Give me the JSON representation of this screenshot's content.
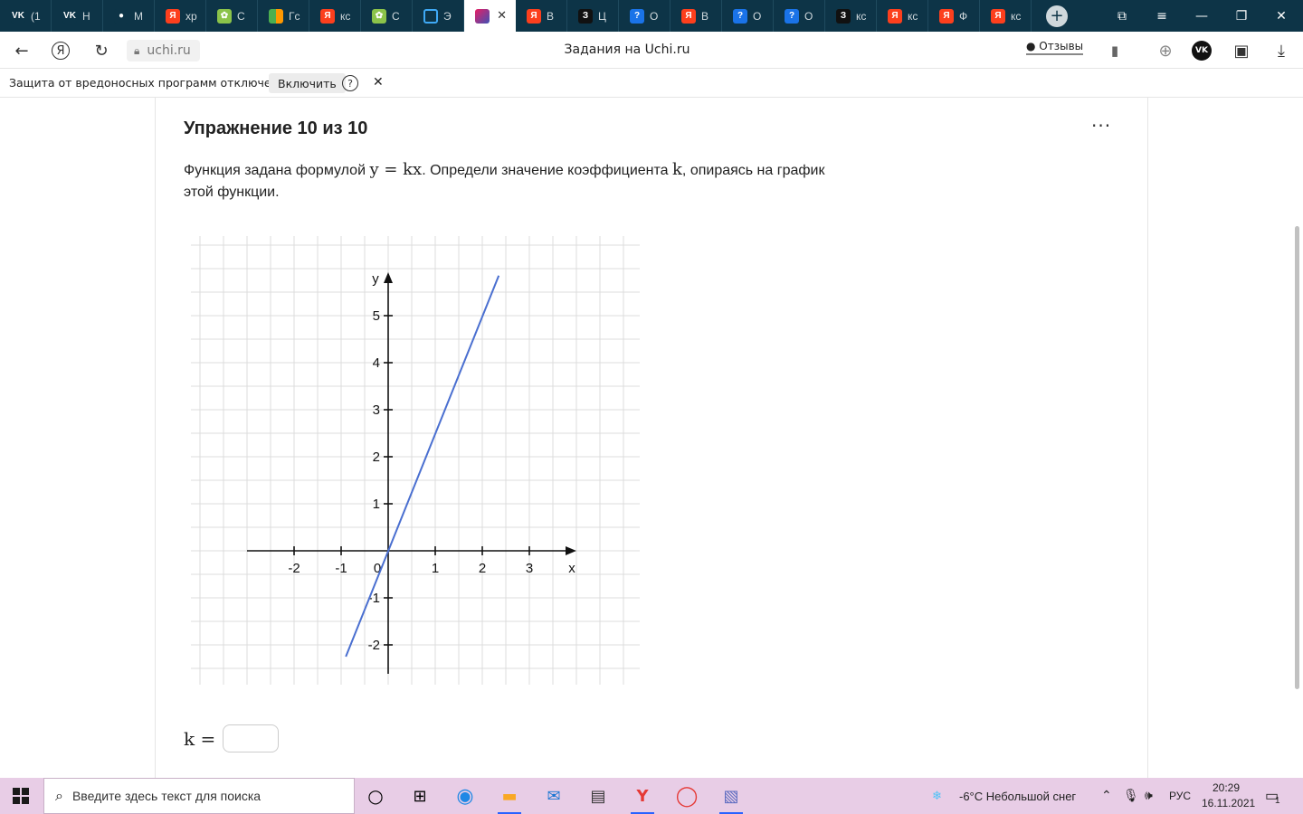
{
  "tabs": [
    {
      "label": "(1",
      "icon": "vk-icon",
      "fav": "VK",
      "cls": "fav-vk"
    },
    {
      "label": "Н",
      "icon": "vk-icon",
      "fav": "VK",
      "cls": "fav-vk"
    },
    {
      "label": "М",
      "icon": "chat-icon",
      "fav": "●",
      "cls": "fav-chat"
    },
    {
      "label": "хр",
      "icon": "yandex-icon",
      "fav": "Я",
      "cls": "fav-ya"
    },
    {
      "label": "С",
      "icon": "flower-icon",
      "fav": "✿",
      "cls": "fav-green"
    },
    {
      "label": "Гс",
      "icon": "book-icon",
      "fav": "",
      "cls": "fav-book"
    },
    {
      "label": "кс",
      "icon": "yandex-icon",
      "fav": "Я",
      "cls": "fav-ya"
    },
    {
      "label": "С",
      "icon": "flower-icon",
      "fav": "✿",
      "cls": "fav-green"
    },
    {
      "label": "Э",
      "icon": "edge-icon",
      "fav": "",
      "cls": "fav-edge"
    },
    {
      "label": "",
      "icon": "uchi-icon",
      "fav": "",
      "cls": "fav-uchi",
      "active": true
    },
    {
      "label": "В",
      "icon": "yandex-icon",
      "fav": "Я",
      "cls": "fav-ya"
    },
    {
      "label": "Ц",
      "icon": "z-icon",
      "fav": "З",
      "cls": "fav-z"
    },
    {
      "label": "О",
      "icon": "question-icon",
      "fav": "?",
      "cls": "fav-q"
    },
    {
      "label": "В",
      "icon": "yandex-icon",
      "fav": "Я",
      "cls": "fav-ya"
    },
    {
      "label": "О",
      "icon": "question-icon",
      "fav": "?",
      "cls": "fav-q"
    },
    {
      "label": "О",
      "icon": "question-icon",
      "fav": "?",
      "cls": "fav-q"
    },
    {
      "label": "кс",
      "icon": "z-icon",
      "fav": "З",
      "cls": "fav-z"
    },
    {
      "label": "кс",
      "icon": "yandex-icon",
      "fav": "Я",
      "cls": "fav-ya"
    },
    {
      "label": "Ф",
      "icon": "yandex-icon",
      "fav": "Я",
      "cls": "fav-ya"
    },
    {
      "label": "кс",
      "icon": "yandex-icon",
      "fav": "Я",
      "cls": "fav-ya"
    }
  ],
  "address": {
    "domain": "uchi.ru",
    "title": "Задания на Uchi.ru",
    "reviews": "Отзывы"
  },
  "protection": {
    "text": "Защита от вредоносных программ отключена",
    "enable": "Включить",
    "help": "?",
    "close": "✕"
  },
  "exercise": {
    "title": "Упражнение 10 из 10",
    "menu": "···",
    "text_1": "Функция задана формулой ",
    "formula": "y = kx",
    "text_2": ". Определи значение коэффициента ",
    "k": "k",
    "text_3": ", опираясь на график этой функции.",
    "answer_label": "k ="
  },
  "chart_data": {
    "type": "line",
    "xlabel": "x",
    "ylabel": "y",
    "x_ticks": [
      "-2",
      "-1",
      "0",
      "1",
      "2",
      "3"
    ],
    "y_ticks": [
      "-2",
      "-1",
      "1",
      "2",
      "3",
      "4",
      "5"
    ],
    "series": [
      {
        "x": [
          -0.9,
          2.35
        ],
        "y": [
          -2.25,
          5.85
        ]
      }
    ],
    "line_color": "#4a6fd0",
    "grid": true
  },
  "taskbar": {
    "search_placeholder": "Введите здесь текст для поиска",
    "weather": "-6°C  Небольшой снег",
    "lang": "РУС",
    "time": "20:29",
    "date": "16.11.2021",
    "notif_count": "1"
  }
}
